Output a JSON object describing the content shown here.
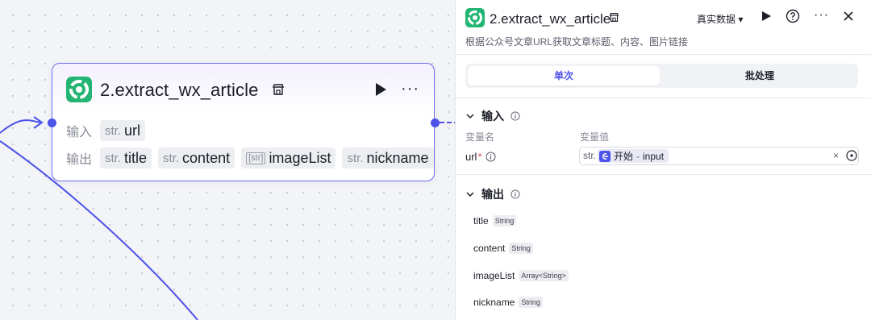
{
  "node": {
    "title": "2.extract_wx_article",
    "input_label": "输入",
    "output_label": "输出",
    "inputs": [
      {
        "type": "str.",
        "name": "url"
      }
    ],
    "outputs": [
      {
        "type": "str.",
        "name": "title"
      },
      {
        "type": "str.",
        "name": "content"
      },
      {
        "type": "[str]",
        "name": "imageList"
      },
      {
        "type": "str.",
        "name": "nickname"
      }
    ],
    "more_label": "···"
  },
  "panel": {
    "title": "2.extract_wx_article",
    "data_source": "真实数据 ▾",
    "more_label": "···",
    "description": "根据公众号文章URL获取文章标题、内容、图片链接",
    "tabs": [
      {
        "label": "单次",
        "active": true
      },
      {
        "label": "批处理",
        "active": false
      }
    ],
    "input_section": {
      "title": "输入",
      "col_name": "变量名",
      "col_value": "变量值",
      "param_name": "url",
      "required_mark": "*",
      "ref_type": "str.",
      "ref_node": "开始",
      "ref_sep": " - ",
      "ref_var": "input",
      "clear_label": "×"
    },
    "output_section": {
      "title": "输出",
      "items": [
        {
          "name": "title",
          "type": "String"
        },
        {
          "name": "content",
          "type": "String"
        },
        {
          "name": "imageList",
          "type": "Array<String>"
        },
        {
          "name": "nickname",
          "type": "String"
        }
      ]
    }
  },
  "colors": {
    "accent": "#4d53e8",
    "node_border": "#6f6ef0",
    "logo_green": "#22b573"
  }
}
